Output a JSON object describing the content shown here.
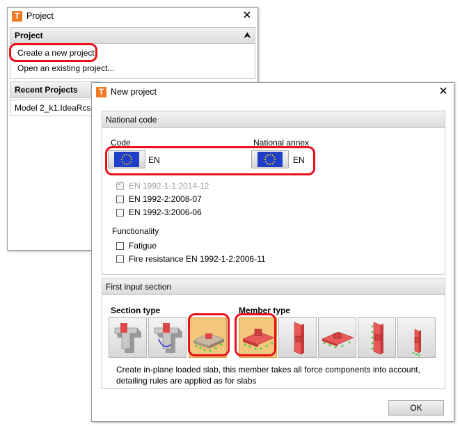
{
  "project_window": {
    "title": "Project",
    "close": "✕",
    "section_header": "Project",
    "collapse": "⮝",
    "create_link": "Create a new project",
    "open_link": "Open an existing project...",
    "recent_header": "Recent Projects",
    "recent_items": [
      "Model 2_k1.IdeaRcs"
    ]
  },
  "new_project_window": {
    "title": "New project",
    "close": "✕",
    "national_code_header": "National code",
    "code_label": "Code",
    "code_value": "EN",
    "annex_label": "National annex",
    "annex_value": "EN",
    "standards": [
      {
        "label": "EN 1992-1-1:2014-12",
        "checked": true,
        "disabled": true
      },
      {
        "label": "EN 1992-2:2008-07",
        "checked": false
      },
      {
        "label": "EN 1992-3:2006-06",
        "checked": false
      }
    ],
    "functionality_label": "Functionality",
    "functionality": [
      {
        "label": "Fatigue",
        "checked": false
      },
      {
        "label": "Fire resistance EN 1992-1-2:2006-11",
        "checked": false
      }
    ],
    "first_input_header": "First input section",
    "section_type_label": "Section type",
    "member_type_label": "Member type",
    "description_line1": "Create in-plane loaded slab, this member takes all force components into account,",
    "description_line2": "detailing rules are applied as for slabs",
    "ok": "OK"
  },
  "colors": {
    "highlight": "#e8101a",
    "selected_tile": "#f5c77e",
    "app_icon": "#f07a22",
    "eu_flag": "#1f3fc9"
  }
}
